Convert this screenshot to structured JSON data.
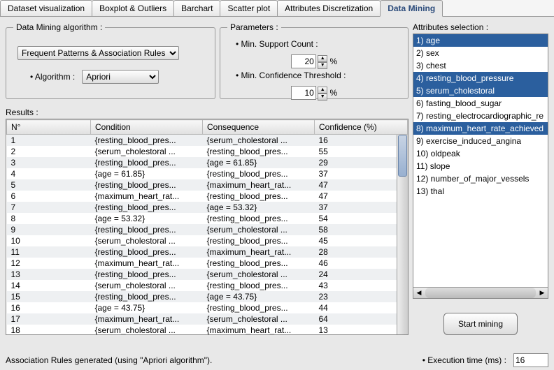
{
  "tabs": [
    "Dataset visualization",
    "Boxplot & Outliers",
    "Barchart",
    "Scatter plot",
    "Attributes Discretization",
    "Data Mining"
  ],
  "activeTab": 5,
  "algo": {
    "legend": "Data Mining algorithm :",
    "typeSelect": "Frequent Patterns & Association Rules",
    "algoLabel": "Algorithm :",
    "algoSelect": "Apriori"
  },
  "params": {
    "legend": "Parameters :",
    "supportLabel": "Min. Support Count :",
    "supportValue": "20",
    "pct": "%",
    "confLabel": "Min. Confidence Threshold :",
    "confValue": "10"
  },
  "attrs": {
    "label": "Attributes selection :",
    "items": [
      {
        "text": "1) age",
        "sel": true
      },
      {
        "text": "2) sex",
        "sel": false
      },
      {
        "text": "3) chest",
        "sel": false
      },
      {
        "text": "4) resting_blood_pressure",
        "sel": true
      },
      {
        "text": "5) serum_cholestoral",
        "sel": true
      },
      {
        "text": "6) fasting_blood_sugar",
        "sel": false
      },
      {
        "text": "7) resting_electrocardiographic_re",
        "sel": false
      },
      {
        "text": "8) maximum_heart_rate_achieved",
        "sel": true
      },
      {
        "text": "9) exercise_induced_angina",
        "sel": false
      },
      {
        "text": "10) oldpeak",
        "sel": false
      },
      {
        "text": "11) slope",
        "sel": false
      },
      {
        "text": "12) number_of_major_vessels",
        "sel": false
      },
      {
        "text": "13) thal",
        "sel": false
      }
    ],
    "startBtn": "Start mining"
  },
  "results": {
    "label": "Results :",
    "headers": [
      "N°",
      "Condition",
      "Consequence",
      "Confidence (%)"
    ],
    "rows": [
      [
        "1",
        "{resting_blood_pres...",
        "{serum_cholestoral ...",
        "16"
      ],
      [
        "2",
        "{serum_cholestoral ...",
        "{resting_blood_pres...",
        "55"
      ],
      [
        "3",
        "{resting_blood_pres...",
        "{age = 61.85}",
        "29"
      ],
      [
        "4",
        "{age = 61.85}",
        "{resting_blood_pres...",
        "37"
      ],
      [
        "5",
        "{resting_blood_pres...",
        "{maximum_heart_rat...",
        "47"
      ],
      [
        "6",
        "{maximum_heart_rat...",
        "{resting_blood_pres...",
        "47"
      ],
      [
        "7",
        "{resting_blood_pres...",
        "{age = 53.32}",
        "37"
      ],
      [
        "8",
        "{age = 53.32}",
        "{resting_blood_pres...",
        "54"
      ],
      [
        "9",
        "{resting_blood_pres...",
        "{serum_cholestoral ...",
        "58"
      ],
      [
        "10",
        "{serum_cholestoral ...",
        "{resting_blood_pres...",
        "45"
      ],
      [
        "11",
        "{resting_blood_pres...",
        "{maximum_heart_rat...",
        "28"
      ],
      [
        "12",
        "{maximum_heart_rat...",
        "{resting_blood_pres...",
        "46"
      ],
      [
        "13",
        "{resting_blood_pres...",
        "{serum_cholestoral ...",
        "24"
      ],
      [
        "14",
        "{serum_cholestoral ...",
        "{resting_blood_pres...",
        "43"
      ],
      [
        "15",
        "{resting_blood_pres...",
        "{age = 43.75}",
        "23"
      ],
      [
        "16",
        "{age = 43.75}",
        "{resting_blood_pres...",
        "44"
      ],
      [
        "17",
        "{maximum_heart_rat...",
        "{serum_cholestoral ...",
        "64"
      ],
      [
        "18",
        "{serum_cholestoral ...",
        "{maximum_heart_rat...",
        "13"
      ]
    ]
  },
  "footer": {
    "status": "Association Rules generated (using \"Apriori algorithm\").",
    "execLabel": "Execution time (ms) :",
    "execValue": "16"
  }
}
